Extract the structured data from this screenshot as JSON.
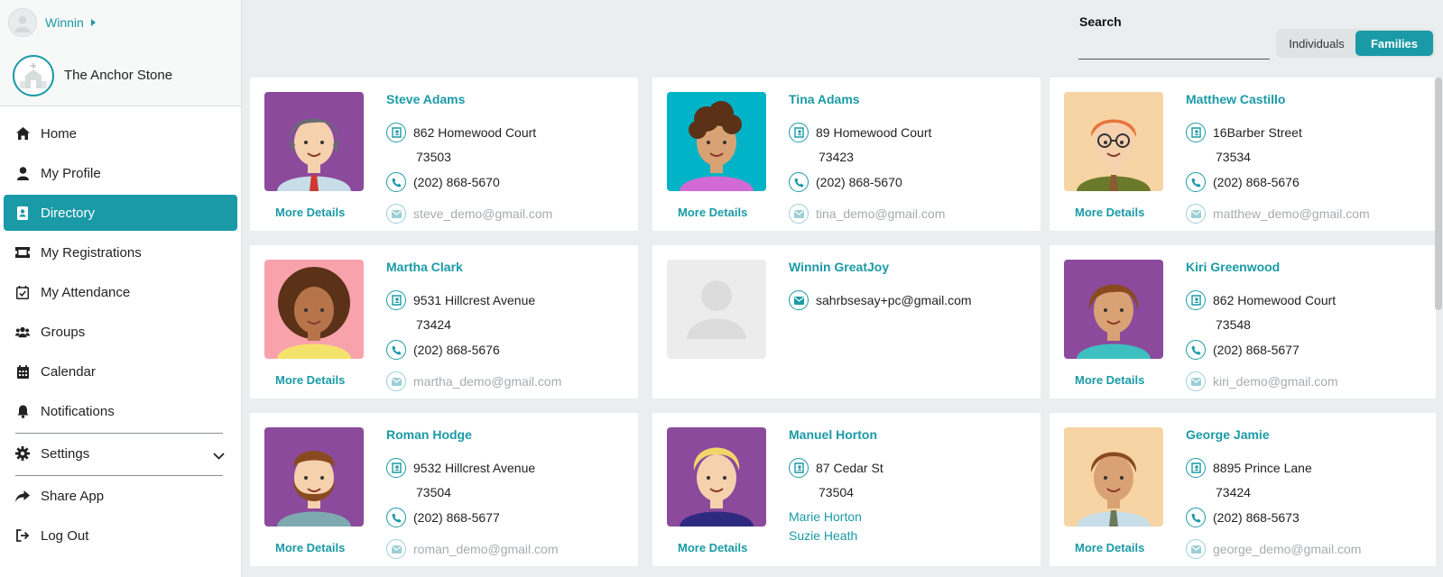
{
  "user": {
    "name": "Winnin"
  },
  "church": {
    "name": "The Anchor Stone"
  },
  "nav": {
    "home": "Home",
    "profile": "My Profile",
    "directory": "Directory",
    "registrations": "My Registrations",
    "attendance": "My Attendance",
    "groups": "Groups",
    "calendar": "Calendar",
    "notifications": "Notifications",
    "settings": "Settings",
    "share": "Share App",
    "logout": "Log Out"
  },
  "search": {
    "label": "Search",
    "placeholder": ""
  },
  "toggle": {
    "individuals": "Individuals",
    "families": "Families",
    "selected": "Families"
  },
  "more_details": "More Details",
  "colors": {
    "accent": "#1a9aa6",
    "purple": "#8b4a9c",
    "teal": "#00b3c7",
    "peach": "#f7d4a3",
    "pink": "#f8a3ac"
  },
  "cards": [
    {
      "name": "Steve Adams",
      "address": "862 Homewood Court",
      "zip": "73503",
      "phone": "(202) 868-5670",
      "email": "steve_demo@gmail.com",
      "bg": "purple",
      "avatar": "man-gray-hair"
    },
    {
      "name": "Tina Adams",
      "address": "89 Homewood Court",
      "zip": "73423",
      "phone": "(202) 868-5670",
      "email": "tina_demo@gmail.com",
      "bg": "teal",
      "avatar": "woman-curly"
    },
    {
      "name": "Matthew Castillo",
      "address": "16Barber Street",
      "zip": "73534",
      "phone": "(202) 868-5676",
      "email": "matthew_demo@gmail.com",
      "bg": "peach",
      "avatar": "man-glasses"
    },
    {
      "name": "Martha Clark",
      "address": "9531 Hillcrest Avenue",
      "zip": "73424",
      "phone": "(202) 868-5676",
      "email": "martha_demo@gmail.com",
      "bg": "pink",
      "avatar": "woman-afro"
    },
    {
      "name": "Winnin GreatJoy",
      "email_only": "sahrbsesay+pc@gmail.com",
      "avatar": "placeholder"
    },
    {
      "name": "Kiri Greenwood",
      "address": "862 Homewood Court",
      "zip": "73548",
      "phone": "(202) 868-5677",
      "email": "kiri_demo@gmail.com",
      "bg": "purple",
      "avatar": "woman-short-hair"
    },
    {
      "name": "Roman Hodge",
      "address": "9532 Hillcrest Avenue",
      "zip": "73504",
      "phone": "(202) 868-5677",
      "email": "roman_demo@gmail.com",
      "bg": "purple",
      "avatar": "man-beard"
    },
    {
      "name": "Manuel Horton",
      "address": "87 Cedar St",
      "zip": "73504",
      "members": [
        "Marie Horton",
        "Suzie Heath"
      ],
      "bg": "purple",
      "avatar": "man-blond"
    },
    {
      "name": "George Jamie",
      "address": "8895 Prince Lane",
      "zip": "73424",
      "phone": "(202) 868-5673",
      "email": "george_demo@gmail.com",
      "bg": "peach",
      "avatar": "man-tie"
    }
  ]
}
